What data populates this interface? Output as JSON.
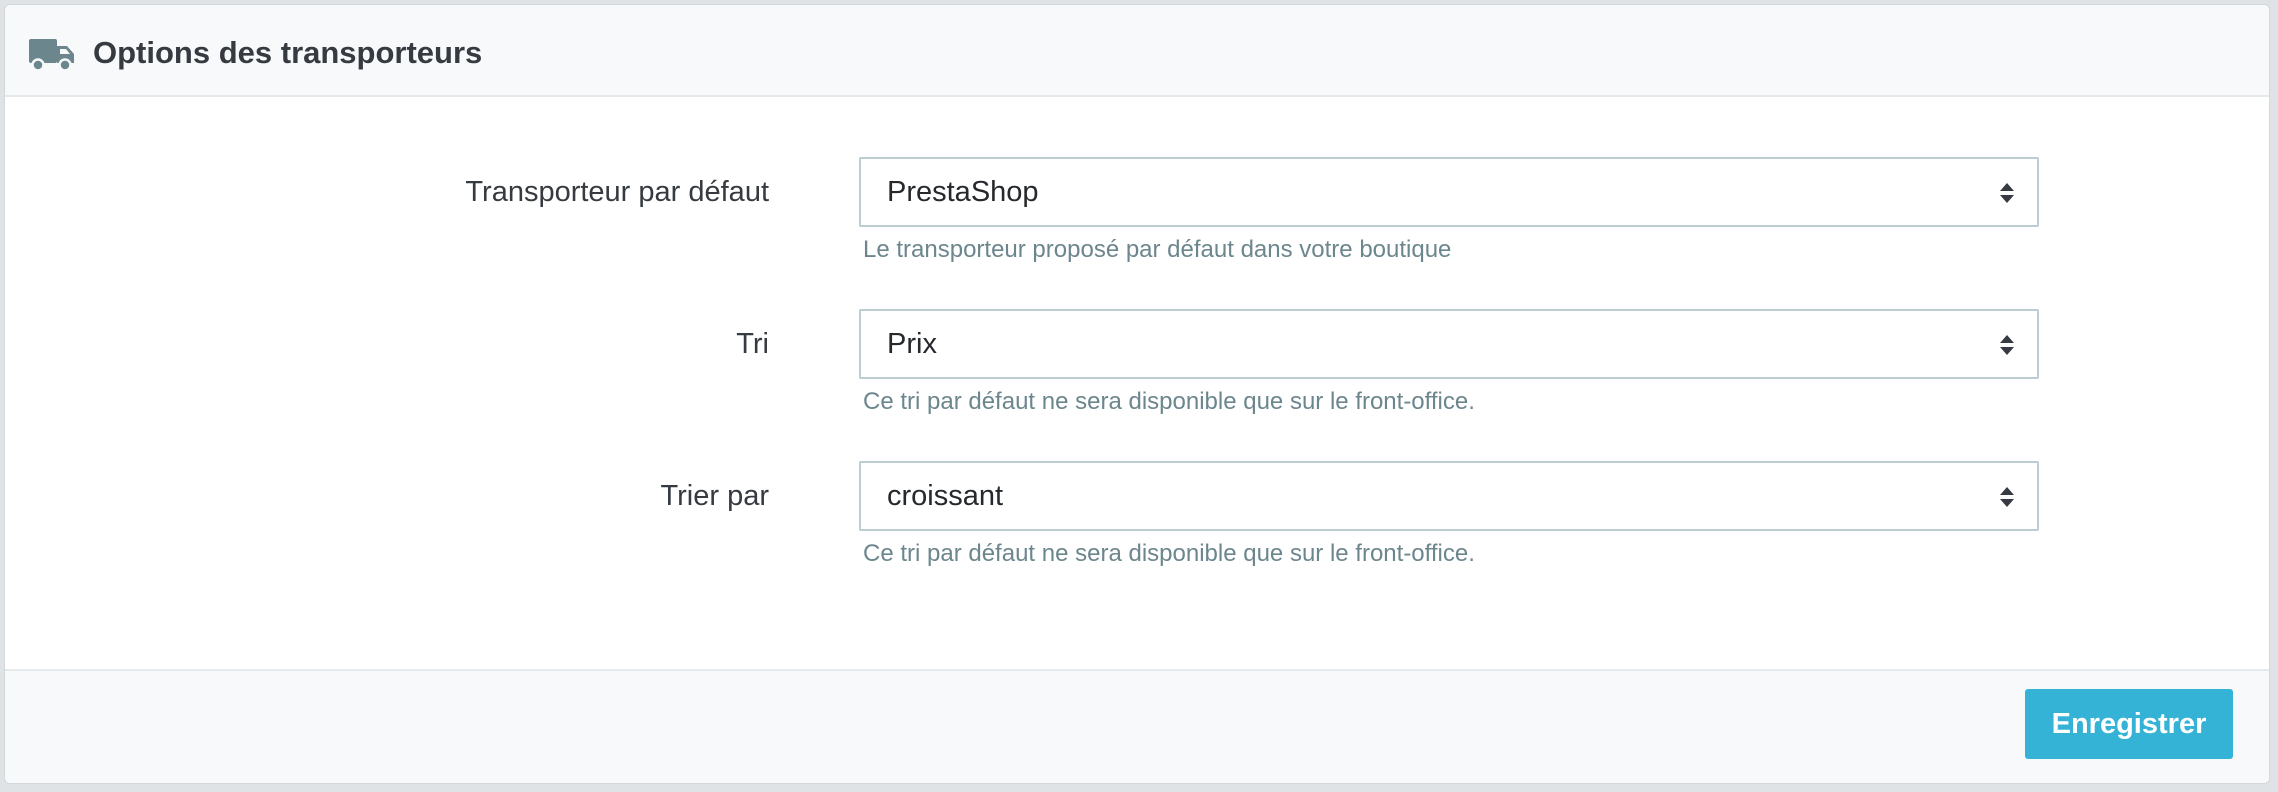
{
  "panel": {
    "title": "Options des transporteurs",
    "icon": "truck-icon"
  },
  "form": {
    "fields": [
      {
        "label": "Transporteur par défaut",
        "value": "PrestaShop",
        "help": "Le transporteur proposé par défaut dans votre boutique"
      },
      {
        "label": "Tri",
        "value": "Prix",
        "help": "Ce tri par défaut ne sera disponible que sur le front-office."
      },
      {
        "label": "Trier par",
        "value": "croissant",
        "help": "Ce tri par défaut ne sera disponible que sur le front-office."
      }
    ]
  },
  "footer": {
    "save_label": "Enregistrer"
  },
  "colors": {
    "accent": "#25b9d7",
    "help_text": "#6c868e",
    "input_border": "#bbcdd2",
    "icon_gray": "#6c868e"
  }
}
